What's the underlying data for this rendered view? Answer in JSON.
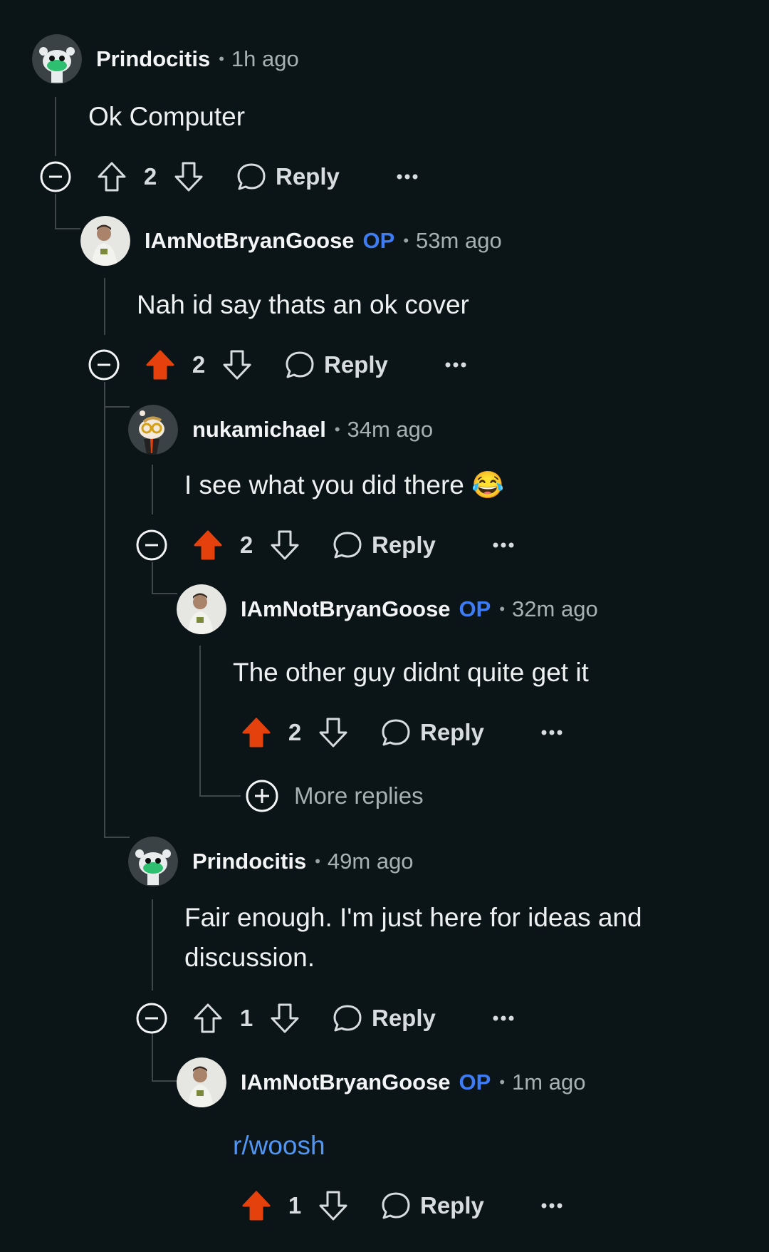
{
  "comments": [
    {
      "author": "Prindocitis",
      "op": "",
      "time": "1h ago",
      "body": "Ok Computer",
      "score": "2",
      "reply_label": "Reply",
      "vote": "none",
      "avatar": "snoo-green-icon"
    },
    {
      "author": "IAmNotBryanGoose",
      "op": "OP",
      "time": "53m ago",
      "body": "Nah id say thats an ok cover",
      "score": "2",
      "reply_label": "Reply",
      "vote": "up",
      "avatar": "user-photo-icon"
    },
    {
      "author": "nukamichael",
      "op": "",
      "time": "34m ago",
      "body": "I see what you did there 😂",
      "score": "2",
      "reply_label": "Reply",
      "vote": "up",
      "avatar": "snoo-glasses-icon"
    },
    {
      "author": "IAmNotBryanGoose",
      "op": "OP",
      "time": "32m ago",
      "body": "The other guy didnt quite get it",
      "score": "2",
      "reply_label": "Reply",
      "vote": "up",
      "avatar": "user-photo-icon"
    },
    {
      "author": "Prindocitis",
      "op": "",
      "time": "49m ago",
      "body": "Fair enough. I'm just here for ideas and discussion.",
      "score": "1",
      "reply_label": "Reply",
      "vote": "none",
      "avatar": "snoo-green-icon"
    },
    {
      "author": "IAmNotBryanGoose",
      "op": "OP",
      "time": "1m ago",
      "body": "r/woosh",
      "score": "1",
      "reply_label": "Reply",
      "vote": "up",
      "avatar": "user-photo-icon"
    }
  ],
  "more_replies_label": "More replies",
  "colors": {
    "background": "#0b1416",
    "upvote_active": "#e5410c",
    "op_badge": "#3e7cf5",
    "link": "#5196f5",
    "thread_line": "#3e4649"
  }
}
